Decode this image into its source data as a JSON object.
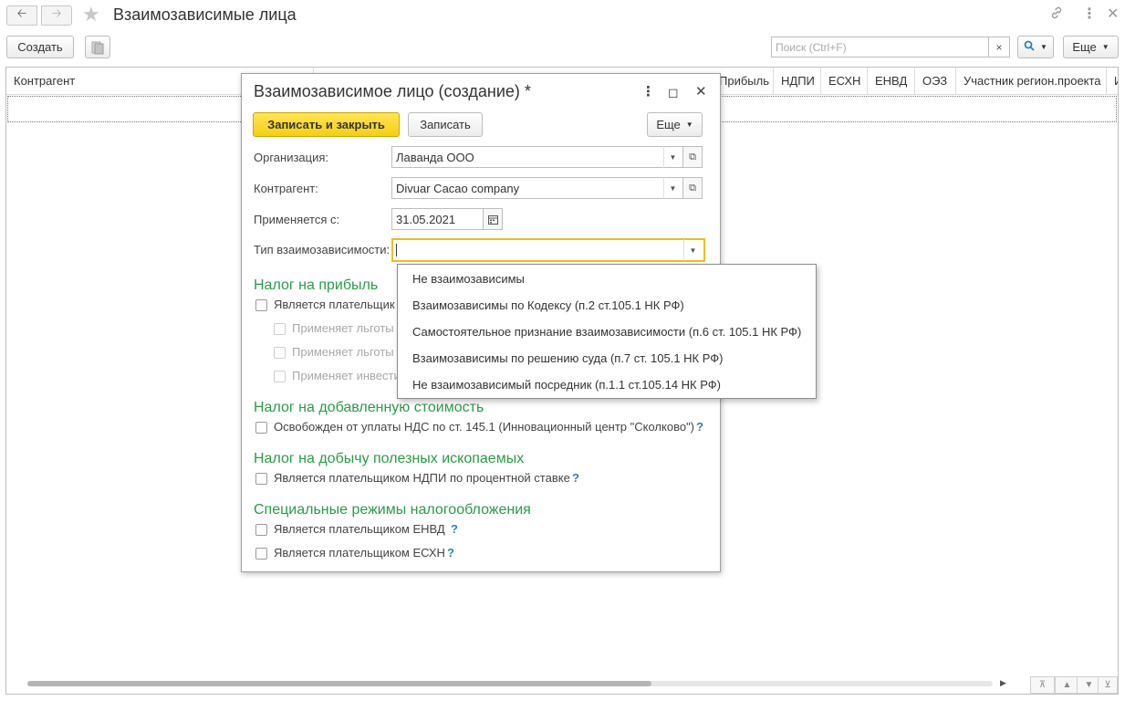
{
  "window": {
    "title": "Взаимозависимые лица"
  },
  "toolbar": {
    "create_label": "Создать",
    "search_placeholder": "Поиск (Ctrl+F)",
    "search_clear": "×",
    "more_label": "Еще"
  },
  "table": {
    "columns": [
      "Контрагент",
      "Прибыль",
      "НДПИ",
      "ЕСХН",
      "ЕНВД",
      "ОЭЗ",
      "Участник регион.проекта",
      "И"
    ]
  },
  "dialog": {
    "title": "Взаимозависимое лицо (создание) *",
    "save_close_label": "Записать и закрыть",
    "save_label": "Записать",
    "more_label": "Еще",
    "fields": {
      "organization_label": "Организация:",
      "organization_value": "Лаванда ООО",
      "counterparty_label": "Контрагент:",
      "counterparty_value": "Divuar Cacao company",
      "applies_from_label": "Применяется с:",
      "applies_from_value": "31.05.2021",
      "dependency_type_label": "Тип взаимозависимости:",
      "dependency_type_value": ""
    },
    "sections": {
      "profit_tax": {
        "title": "Налог на прибыль",
        "items": [
          "Является плательщик",
          "Применяет льготы",
          "Применяет льготы",
          "Применяет инвести"
        ]
      },
      "vat": {
        "title": "Налог на добавленную стоимость",
        "item": "Освобожден от уплаты НДС по ст. 145.1 (Инновационный центр \"Сколково\")"
      },
      "mineral_tax": {
        "title": "Налог на добычу полезных ископаемых",
        "item": "Является плательщиком НДПИ по процентной ставке"
      },
      "special": {
        "title": "Специальные режимы налогообложения",
        "items": [
          "Является плательщиком ЕНВД",
          "Является плательщиком ЕСХН"
        ]
      }
    },
    "help_mark": "?"
  },
  "dropdown": {
    "options": [
      "Не взаимозависимы",
      "Взаимозависимы по Кодексу (п.2 ст.105.1 НК РФ)",
      "Самостоятельное признание взаимозависимости (п.6 ст. 105.1 НК РФ)",
      "Взаимозависимы по решению суда (п.7 ст. 105.1 НК РФ)",
      "Не взаимозависимый посредник (п.1.1 ст.105.14 НК РФ)"
    ]
  },
  "colors": {
    "accent_yellow": "#f5cf14",
    "section_green": "#2b9b48",
    "help_blue": "#2f7fc1",
    "focus_border": "#e8c020"
  }
}
